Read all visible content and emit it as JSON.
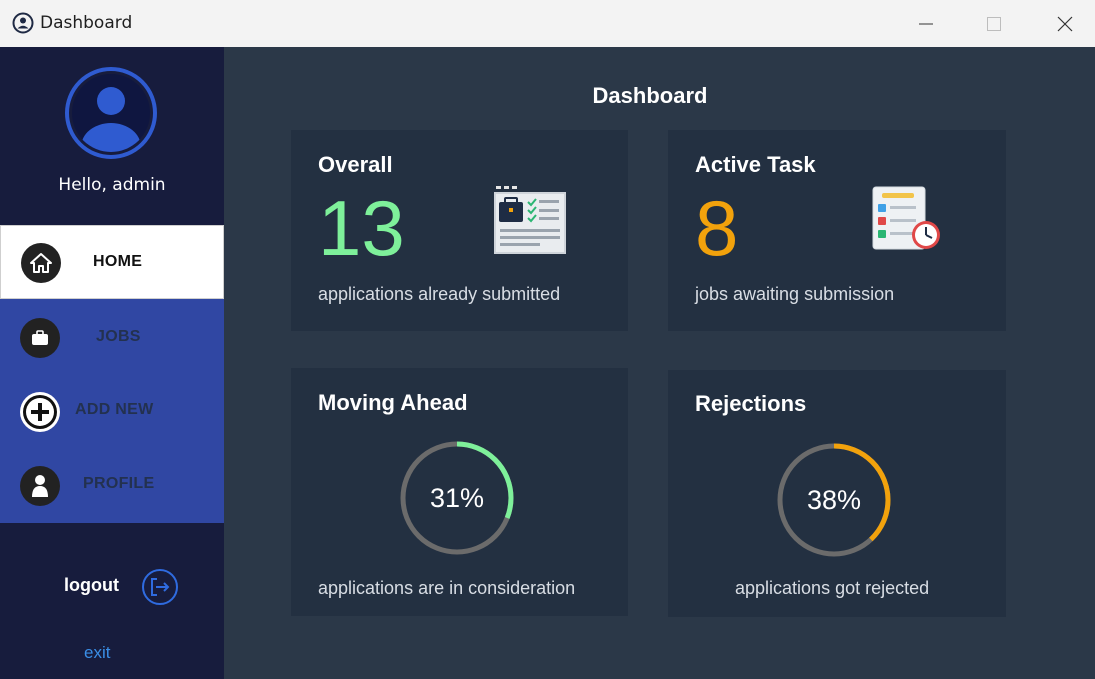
{
  "window": {
    "title": "Dashboard"
  },
  "sidebar": {
    "greeting": "Hello, admin",
    "items": [
      {
        "label": "HOME",
        "icon": "home-icon",
        "active": true
      },
      {
        "label": "JOBS",
        "icon": "briefcase-icon",
        "active": false
      },
      {
        "label": "ADD NEW",
        "icon": "plus-icon",
        "active": false
      },
      {
        "label": "PROFILE",
        "icon": "user-icon",
        "active": false
      }
    ],
    "logout_label": "logout",
    "exit_label": "exit"
  },
  "main": {
    "title": "Dashboard",
    "cards": {
      "overall": {
        "title": "Overall",
        "value": "13",
        "subtitle": "applications already submitted",
        "color": "#7ef09a"
      },
      "active": {
        "title": "Active Task",
        "value": "8",
        "subtitle": "jobs awaiting submission",
        "color": "#f2a20c"
      },
      "moving": {
        "title": "Moving Ahead",
        "percent_label": "31%",
        "percent": 31,
        "subtitle": "applications are in consideration",
        "color": "#7ef09a"
      },
      "rejections": {
        "title": "Rejections",
        "percent_label": "38%",
        "percent": 38,
        "subtitle": "applications got rejected",
        "color": "#f2a20c"
      }
    }
  },
  "colors": {
    "sidebar_bg": "#171c3d",
    "nav_bg": "#3047a3",
    "main_bg": "#2b3848",
    "card_bg": "#233041",
    "ring_track": "#6b6b6b"
  }
}
